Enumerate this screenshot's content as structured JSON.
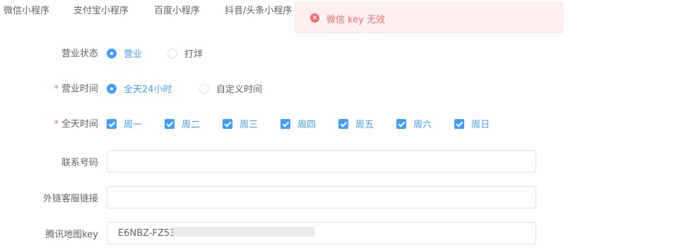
{
  "tabs": [
    "微信小程序",
    "支付宝小程序",
    "百度小程序",
    "抖音/头条小程序"
  ],
  "toast": {
    "message": "微信 key 无效",
    "icon": "error-icon",
    "color": "#f56c6c"
  },
  "form": {
    "status": {
      "label": "营业状态",
      "options": [
        "营业",
        "打烊"
      ],
      "selected": "营业"
    },
    "hours": {
      "label": "营业时间",
      "required": true,
      "options": [
        "全天24小时",
        "自定义时间"
      ],
      "selected": "全天24小时"
    },
    "days": {
      "label": "全天时间",
      "required": true,
      "options": [
        "周一",
        "周二",
        "周三",
        "周四",
        "周五",
        "周六",
        "周日"
      ],
      "checked": [
        "周一",
        "周二",
        "周三",
        "周四",
        "周五",
        "周六",
        "周日"
      ]
    },
    "phone": {
      "label": "联系号码",
      "value": ""
    },
    "service_link": {
      "label": "外链客服链接",
      "value": ""
    },
    "map_key": {
      "label": "腾讯地图key",
      "value": "E6NBZ-FZ53"
    }
  },
  "colors": {
    "accent": "#409eff",
    "danger": "#f56c6c",
    "text": "#606266",
    "border": "#dcdfe6"
  }
}
